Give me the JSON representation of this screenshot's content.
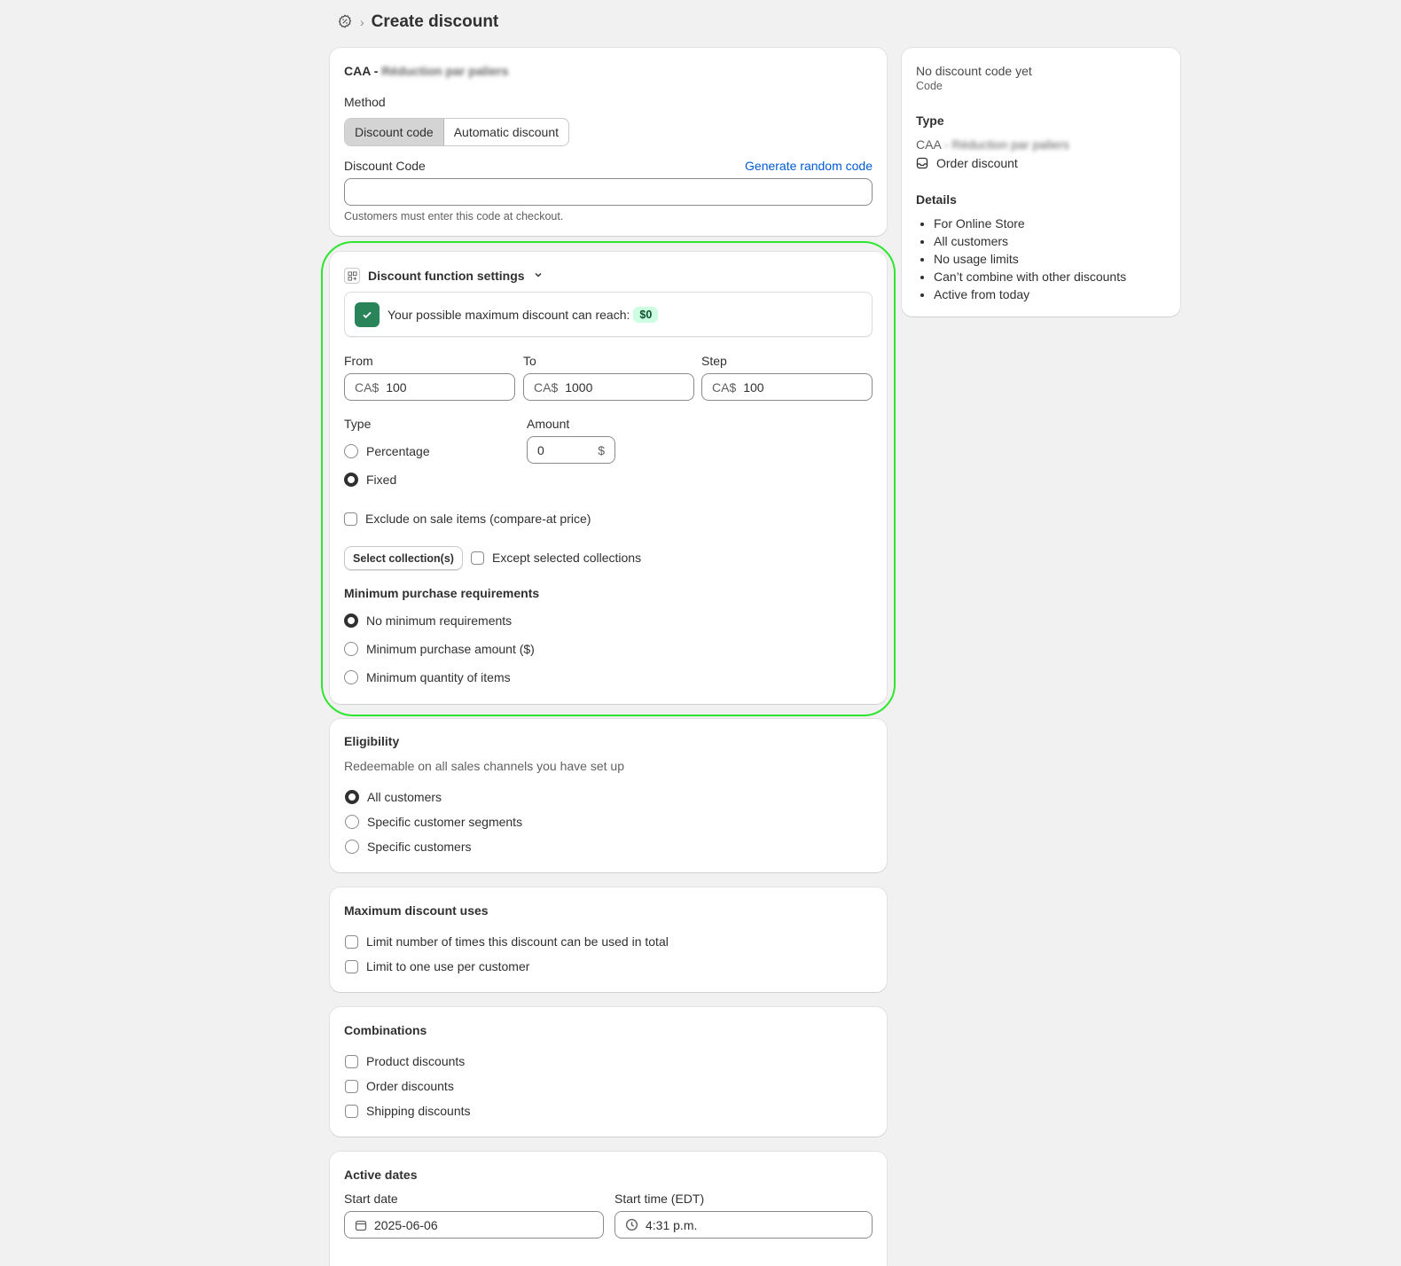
{
  "header": {
    "title": "Create discount",
    "breadcrumb_sep": "›"
  },
  "main_card": {
    "title_prefix": "CAA -",
    "title_blurred": "Réduction par paliers",
    "method_label": "Method",
    "method_options": [
      "Discount code",
      "Automatic discount"
    ],
    "code_label": "Discount Code",
    "generate_link": "Generate random code",
    "code_value": "",
    "code_help": "Customers must enter this code at checkout."
  },
  "function_settings": {
    "title": "Discount function settings",
    "max_text": "Your possible maximum discount can reach:",
    "max_value": "$0",
    "from_label": "From",
    "to_label": "To",
    "step_label": "Step",
    "currency": "CA$",
    "from_value": "100",
    "to_value": "1000",
    "step_value": "100",
    "type_label": "Type",
    "amount_label": "Amount",
    "type_options": [
      "Percentage",
      "Fixed"
    ],
    "amount_value": "0",
    "amount_suffix": "$",
    "exclude_sale": "Exclude on sale items (compare-at price)",
    "select_collections": "Select collection(s)",
    "except_collections": "Except selected collections",
    "min_req_label": "Minimum purchase requirements",
    "min_req_options": [
      "No minimum requirements",
      "Minimum purchase amount ($)",
      "Minimum quantity of items"
    ]
  },
  "eligibility": {
    "title": "Eligibility",
    "subtitle": "Redeemable on all sales channels you have set up",
    "options": [
      "All customers",
      "Specific customer segments",
      "Specific customers"
    ]
  },
  "max_uses": {
    "title": "Maximum discount uses",
    "options": [
      "Limit number of times this discount can be used in total",
      "Limit to one use per customer"
    ]
  },
  "combinations": {
    "title": "Combinations",
    "options": [
      "Product discounts",
      "Order discounts",
      "Shipping discounts"
    ]
  },
  "active_dates": {
    "title": "Active dates",
    "start_date_label": "Start date",
    "start_time_label": "Start time (EDT)",
    "start_date": "2025-06-06",
    "start_time": "4:31 p.m."
  },
  "summary": {
    "code_title": "No discount code yet",
    "code_sub": "Code",
    "type_label": "Type",
    "type_name_prefix": "CAA",
    "type_name_blurred": "- Réduction par paliers",
    "type_value": "Order discount",
    "details_label": "Details",
    "details": [
      "For Online Store",
      "All customers",
      "No usage limits",
      "Can’t combine with other discounts",
      "Active from today"
    ]
  }
}
